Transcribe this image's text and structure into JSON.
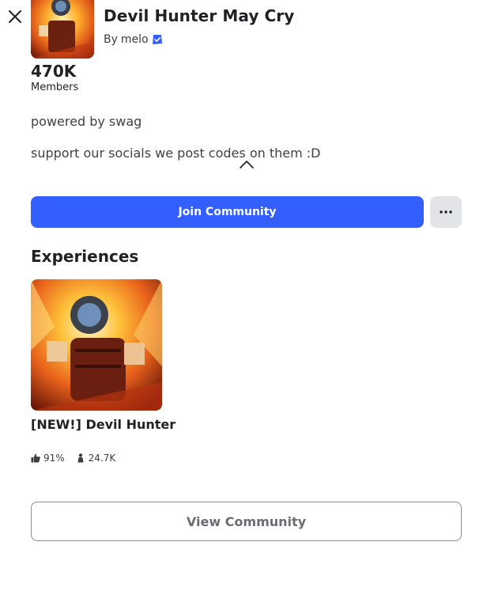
{
  "group": {
    "name": "Devil Hunter May Cry",
    "by_prefix": "By",
    "owner": "melo",
    "members_count": "470K",
    "members_label": "Members",
    "description_lines": [
      "powered by swag",
      "support our socials we post codes on them :D"
    ]
  },
  "actions": {
    "join_label": "Join Community",
    "more_icon": "ellipsis-icon"
  },
  "experiences": {
    "section_title": "Experiences",
    "items": [
      {
        "name": "[NEW!] Devil Hunter",
        "rating": "91%",
        "players": "24.7K"
      }
    ]
  },
  "footer": {
    "view_label": "View Community"
  },
  "colors": {
    "accent": "#335fff",
    "verified": "#335fff"
  }
}
